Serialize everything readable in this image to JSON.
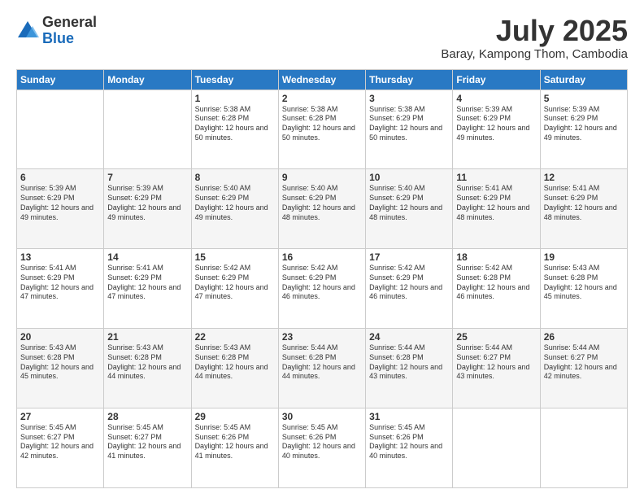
{
  "logo": {
    "general": "General",
    "blue": "Blue"
  },
  "title": "July 2025",
  "location": "Baray, Kampong Thom, Cambodia",
  "days_of_week": [
    "Sunday",
    "Monday",
    "Tuesday",
    "Wednesday",
    "Thursday",
    "Friday",
    "Saturday"
  ],
  "weeks": [
    [
      {
        "day": "",
        "info": ""
      },
      {
        "day": "",
        "info": ""
      },
      {
        "day": "1",
        "info": "Sunrise: 5:38 AM\nSunset: 6:28 PM\nDaylight: 12 hours and 50 minutes."
      },
      {
        "day": "2",
        "info": "Sunrise: 5:38 AM\nSunset: 6:28 PM\nDaylight: 12 hours and 50 minutes."
      },
      {
        "day": "3",
        "info": "Sunrise: 5:38 AM\nSunset: 6:29 PM\nDaylight: 12 hours and 50 minutes."
      },
      {
        "day": "4",
        "info": "Sunrise: 5:39 AM\nSunset: 6:29 PM\nDaylight: 12 hours and 49 minutes."
      },
      {
        "day": "5",
        "info": "Sunrise: 5:39 AM\nSunset: 6:29 PM\nDaylight: 12 hours and 49 minutes."
      }
    ],
    [
      {
        "day": "6",
        "info": "Sunrise: 5:39 AM\nSunset: 6:29 PM\nDaylight: 12 hours and 49 minutes."
      },
      {
        "day": "7",
        "info": "Sunrise: 5:39 AM\nSunset: 6:29 PM\nDaylight: 12 hours and 49 minutes."
      },
      {
        "day": "8",
        "info": "Sunrise: 5:40 AM\nSunset: 6:29 PM\nDaylight: 12 hours and 49 minutes."
      },
      {
        "day": "9",
        "info": "Sunrise: 5:40 AM\nSunset: 6:29 PM\nDaylight: 12 hours and 48 minutes."
      },
      {
        "day": "10",
        "info": "Sunrise: 5:40 AM\nSunset: 6:29 PM\nDaylight: 12 hours and 48 minutes."
      },
      {
        "day": "11",
        "info": "Sunrise: 5:41 AM\nSunset: 6:29 PM\nDaylight: 12 hours and 48 minutes."
      },
      {
        "day": "12",
        "info": "Sunrise: 5:41 AM\nSunset: 6:29 PM\nDaylight: 12 hours and 48 minutes."
      }
    ],
    [
      {
        "day": "13",
        "info": "Sunrise: 5:41 AM\nSunset: 6:29 PM\nDaylight: 12 hours and 47 minutes."
      },
      {
        "day": "14",
        "info": "Sunrise: 5:41 AM\nSunset: 6:29 PM\nDaylight: 12 hours and 47 minutes."
      },
      {
        "day": "15",
        "info": "Sunrise: 5:42 AM\nSunset: 6:29 PM\nDaylight: 12 hours and 47 minutes."
      },
      {
        "day": "16",
        "info": "Sunrise: 5:42 AM\nSunset: 6:29 PM\nDaylight: 12 hours and 46 minutes."
      },
      {
        "day": "17",
        "info": "Sunrise: 5:42 AM\nSunset: 6:29 PM\nDaylight: 12 hours and 46 minutes."
      },
      {
        "day": "18",
        "info": "Sunrise: 5:42 AM\nSunset: 6:28 PM\nDaylight: 12 hours and 46 minutes."
      },
      {
        "day": "19",
        "info": "Sunrise: 5:43 AM\nSunset: 6:28 PM\nDaylight: 12 hours and 45 minutes."
      }
    ],
    [
      {
        "day": "20",
        "info": "Sunrise: 5:43 AM\nSunset: 6:28 PM\nDaylight: 12 hours and 45 minutes."
      },
      {
        "day": "21",
        "info": "Sunrise: 5:43 AM\nSunset: 6:28 PM\nDaylight: 12 hours and 44 minutes."
      },
      {
        "day": "22",
        "info": "Sunrise: 5:43 AM\nSunset: 6:28 PM\nDaylight: 12 hours and 44 minutes."
      },
      {
        "day": "23",
        "info": "Sunrise: 5:44 AM\nSunset: 6:28 PM\nDaylight: 12 hours and 44 minutes."
      },
      {
        "day": "24",
        "info": "Sunrise: 5:44 AM\nSunset: 6:28 PM\nDaylight: 12 hours and 43 minutes."
      },
      {
        "day": "25",
        "info": "Sunrise: 5:44 AM\nSunset: 6:27 PM\nDaylight: 12 hours and 43 minutes."
      },
      {
        "day": "26",
        "info": "Sunrise: 5:44 AM\nSunset: 6:27 PM\nDaylight: 12 hours and 42 minutes."
      }
    ],
    [
      {
        "day": "27",
        "info": "Sunrise: 5:45 AM\nSunset: 6:27 PM\nDaylight: 12 hours and 42 minutes."
      },
      {
        "day": "28",
        "info": "Sunrise: 5:45 AM\nSunset: 6:27 PM\nDaylight: 12 hours and 41 minutes."
      },
      {
        "day": "29",
        "info": "Sunrise: 5:45 AM\nSunset: 6:26 PM\nDaylight: 12 hours and 41 minutes."
      },
      {
        "day": "30",
        "info": "Sunrise: 5:45 AM\nSunset: 6:26 PM\nDaylight: 12 hours and 40 minutes."
      },
      {
        "day": "31",
        "info": "Sunrise: 5:45 AM\nSunset: 6:26 PM\nDaylight: 12 hours and 40 minutes."
      },
      {
        "day": "",
        "info": ""
      },
      {
        "day": "",
        "info": ""
      }
    ]
  ]
}
